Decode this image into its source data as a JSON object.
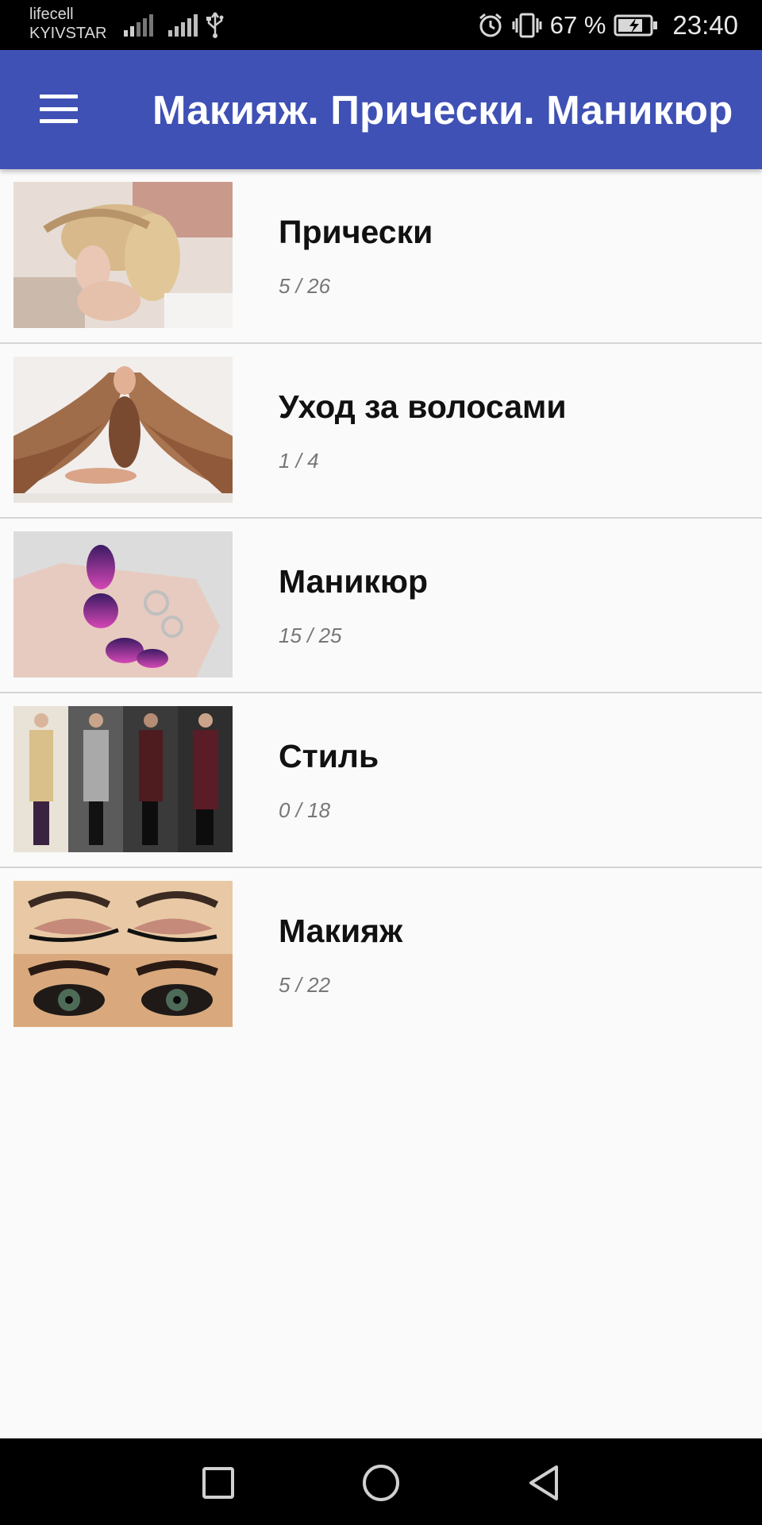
{
  "status_bar": {
    "carrier_1": "lifecell",
    "carrier_2": "KYIVSTAR",
    "battery_percent": "67 %",
    "time": "23:40",
    "icons": [
      "signal-icon",
      "signal-icon",
      "usb-icon",
      "alarm-icon",
      "vibrate-icon",
      "battery-charging-icon"
    ]
  },
  "app_bar": {
    "title": "Макияж. Прически. Маникюр",
    "menu_icon": "hamburger-menu-icon",
    "color": "#3f51b5"
  },
  "categories": [
    {
      "title": "Прически",
      "count": "5 / 26",
      "image": "hairstyle-photo"
    },
    {
      "title": "Уход за волосами",
      "count": "1 / 4",
      "image": "hair-care-photo"
    },
    {
      "title": "Маникюр",
      "count": "15 / 25",
      "image": "manicure-photo"
    },
    {
      "title": "Стиль",
      "count": "0 / 18",
      "image": "style-photo"
    },
    {
      "title": "Макияж",
      "count": "5 / 22",
      "image": "makeup-photo"
    }
  ],
  "nav_bar": {
    "icons": [
      "recent-apps-icon",
      "home-icon",
      "back-icon"
    ]
  }
}
